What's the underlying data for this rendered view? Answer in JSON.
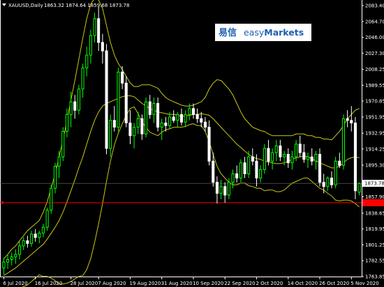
{
  "header": {
    "symbol_text": "XAUUSD,Daily",
    "ohlc_text": "1863.32 1874.64 1859.68 1873.78"
  },
  "logo": {
    "cn_text": "易信",
    "brand_prefix": "easy",
    "brand_suffix": "Markets"
  },
  "colors": {
    "background": "#000000",
    "candle_up": "#00ff00",
    "candle_down": "#ffffff",
    "bands": "#c8c814",
    "price_line": "#ff0000",
    "axis": "#ffffff",
    "logo_text": "#1d5fb0"
  },
  "chart_data": {
    "type": "candlestick",
    "symbol": "XAUUSD",
    "timeframe": "Daily",
    "ylim": [
      1763.85,
      2090
    ],
    "y_ticks": [
      {
        "value": 2083.4,
        "label": "2083.40"
      },
      {
        "value": 2064.7,
        "label": "2064.70"
      },
      {
        "value": 2046.0,
        "label": "2046.00"
      },
      {
        "value": 2027.3,
        "label": "2027.30"
      },
      {
        "value": 2008.25,
        "label": "2008.25"
      },
      {
        "value": 1989.55,
        "label": "1989.55"
      },
      {
        "value": 1970.85,
        "label": "1970.85"
      },
      {
        "value": 1951.95,
        "label": "1951.95"
      },
      {
        "value": 1932.95,
        "label": "1932.95"
      },
      {
        "value": 1914.25,
        "label": "1914.25"
      },
      {
        "value": 1895.3,
        "label": "1895.30"
      },
      {
        "value": 1857.9,
        "label": "1857.90"
      },
      {
        "value": 1838.65,
        "label": "1838.65"
      },
      {
        "value": 1819.95,
        "label": "1819.95"
      },
      {
        "value": 1801.25,
        "label": "1801.25"
      },
      {
        "value": 1782.55,
        "label": "1782.55"
      },
      {
        "value": 1763.85,
        "label": "1763.85"
      }
    ],
    "current_price_label": {
      "value": 1873.78,
      "label": "1873.78"
    },
    "horizontal_line": {
      "value": 1850.9,
      "label": ""
    },
    "x_ticks": [
      {
        "index": 0,
        "label": "6 Jul 2020"
      },
      {
        "index": 8,
        "label": "16 Jul 2020"
      },
      {
        "index": 17,
        "label": "28 Jul 2020"
      },
      {
        "index": 24,
        "label": "7 Aug 2020"
      },
      {
        "index": 32,
        "label": "19 Aug 2020"
      },
      {
        "index": 40,
        "label": "31 Aug 2020"
      },
      {
        "index": 48,
        "label": "10 Sep 2020"
      },
      {
        "index": 56,
        "label": "22 Sep 2020"
      },
      {
        "index": 64,
        "label": "2 Oct 2020"
      },
      {
        "index": 72,
        "label": "14 Oct 2020"
      },
      {
        "index": 80,
        "label": "26 Oct 2020"
      },
      {
        "index": 88,
        "label": "5 Nov 2020"
      }
    ],
    "candles": [
      {
        "o": 1774,
        "h": 1786,
        "l": 1766,
        "c": 1781
      },
      {
        "o": 1781,
        "h": 1790,
        "l": 1773,
        "c": 1784
      },
      {
        "o": 1784,
        "h": 1792,
        "l": 1777,
        "c": 1787
      },
      {
        "o": 1787,
        "h": 1796,
        "l": 1779,
        "c": 1790
      },
      {
        "o": 1790,
        "h": 1805,
        "l": 1784,
        "c": 1800
      },
      {
        "o": 1800,
        "h": 1810,
        "l": 1795,
        "c": 1806
      },
      {
        "o": 1806,
        "h": 1812,
        "l": 1798,
        "c": 1803
      },
      {
        "o": 1803,
        "h": 1818,
        "l": 1799,
        "c": 1814
      },
      {
        "o": 1814,
        "h": 1820,
        "l": 1805,
        "c": 1810
      },
      {
        "o": 1810,
        "h": 1818,
        "l": 1803,
        "c": 1815
      },
      {
        "o": 1815,
        "h": 1826,
        "l": 1810,
        "c": 1822
      },
      {
        "o": 1822,
        "h": 1845,
        "l": 1818,
        "c": 1842
      },
      {
        "o": 1842,
        "h": 1872,
        "l": 1838,
        "c": 1868
      },
      {
        "o": 1868,
        "h": 1898,
        "l": 1862,
        "c": 1894
      },
      {
        "o": 1894,
        "h": 1912,
        "l": 1880,
        "c": 1905
      },
      {
        "o": 1905,
        "h": 1940,
        "l": 1900,
        "c": 1935
      },
      {
        "o": 1935,
        "h": 1962,
        "l": 1928,
        "c": 1955
      },
      {
        "o": 1955,
        "h": 1982,
        "l": 1940,
        "c": 1970
      },
      {
        "o": 1970,
        "h": 1978,
        "l": 1950,
        "c": 1960
      },
      {
        "o": 1960,
        "h": 1990,
        "l": 1955,
        "c": 1985
      },
      {
        "o": 1985,
        "h": 2015,
        "l": 1975,
        "c": 2010
      },
      {
        "o": 2010,
        "h": 2035,
        "l": 2000,
        "c": 2025
      },
      {
        "o": 2025,
        "h": 2055,
        "l": 2015,
        "c": 2048
      },
      {
        "o": 2048,
        "h": 2075,
        "l": 2040,
        "c": 2068
      },
      {
        "o": 2068,
        "h": 2082,
        "l": 2030,
        "c": 2040
      },
      {
        "o": 2040,
        "h": 2050,
        "l": 2015,
        "c": 2030
      },
      {
        "o": 2030,
        "h": 2038,
        "l": 1908,
        "c": 1915
      },
      {
        "o": 1915,
        "h": 1955,
        "l": 1905,
        "c": 1948
      },
      {
        "o": 1948,
        "h": 1965,
        "l": 1935,
        "c": 1940
      },
      {
        "o": 1940,
        "h": 2010,
        "l": 1935,
        "c": 2005
      },
      {
        "o": 2005,
        "h": 2012,
        "l": 1985,
        "c": 1992
      },
      {
        "o": 1992,
        "h": 2000,
        "l": 1940,
        "c": 1945
      },
      {
        "o": 1945,
        "h": 1960,
        "l": 1920,
        "c": 1930
      },
      {
        "o": 1930,
        "h": 1945,
        "l": 1915,
        "c": 1940
      },
      {
        "o": 1940,
        "h": 1958,
        "l": 1932,
        "c": 1950
      },
      {
        "o": 1950,
        "h": 1955,
        "l": 1925,
        "c": 1932
      },
      {
        "o": 1932,
        "h": 1975,
        "l": 1928,
        "c": 1970
      },
      {
        "o": 1970,
        "h": 1978,
        "l": 1950,
        "c": 1955
      },
      {
        "o": 1955,
        "h": 1975,
        "l": 1945,
        "c": 1968
      },
      {
        "o": 1968,
        "h": 1975,
        "l": 1935,
        "c": 1940
      },
      {
        "o": 1940,
        "h": 1950,
        "l": 1925,
        "c": 1945
      },
      {
        "o": 1945,
        "h": 1952,
        "l": 1935,
        "c": 1942
      },
      {
        "o": 1942,
        "h": 1958,
        "l": 1938,
        "c": 1952
      },
      {
        "o": 1952,
        "h": 1960,
        "l": 1945,
        "c": 1948
      },
      {
        "o": 1948,
        "h": 1958,
        "l": 1940,
        "c": 1955
      },
      {
        "o": 1955,
        "h": 1962,
        "l": 1942,
        "c": 1946
      },
      {
        "o": 1946,
        "h": 1960,
        "l": 1940,
        "c": 1955
      },
      {
        "o": 1955,
        "h": 1968,
        "l": 1948,
        "c": 1962
      },
      {
        "o": 1962,
        "h": 1968,
        "l": 1950,
        "c": 1955
      },
      {
        "o": 1955,
        "h": 1962,
        "l": 1945,
        "c": 1950
      },
      {
        "o": 1950,
        "h": 1958,
        "l": 1940,
        "c": 1946
      },
      {
        "o": 1946,
        "h": 1952,
        "l": 1935,
        "c": 1940
      },
      {
        "o": 1940,
        "h": 1948,
        "l": 1895,
        "c": 1900
      },
      {
        "o": 1900,
        "h": 1910,
        "l": 1870,
        "c": 1875
      },
      {
        "o": 1875,
        "h": 1882,
        "l": 1850,
        "c": 1862
      },
      {
        "o": 1862,
        "h": 1878,
        "l": 1855,
        "c": 1870
      },
      {
        "o": 1870,
        "h": 1875,
        "l": 1851,
        "c": 1860
      },
      {
        "o": 1860,
        "h": 1880,
        "l": 1855,
        "c": 1875
      },
      {
        "o": 1875,
        "h": 1890,
        "l": 1868,
        "c": 1885
      },
      {
        "o": 1885,
        "h": 1895,
        "l": 1875,
        "c": 1880
      },
      {
        "o": 1880,
        "h": 1902,
        "l": 1875,
        "c": 1898
      },
      {
        "o": 1898,
        "h": 1905,
        "l": 1880,
        "c": 1885
      },
      {
        "o": 1885,
        "h": 1912,
        "l": 1880,
        "c": 1905
      },
      {
        "o": 1905,
        "h": 1915,
        "l": 1895,
        "c": 1900
      },
      {
        "o": 1900,
        "h": 1908,
        "l": 1870,
        "c": 1880
      },
      {
        "o": 1880,
        "h": 1895,
        "l": 1875,
        "c": 1890
      },
      {
        "o": 1890,
        "h": 1920,
        "l": 1885,
        "c": 1915
      },
      {
        "o": 1915,
        "h": 1925,
        "l": 1895,
        "c": 1900
      },
      {
        "o": 1900,
        "h": 1915,
        "l": 1890,
        "c": 1910
      },
      {
        "o": 1910,
        "h": 1925,
        "l": 1900,
        "c": 1918
      },
      {
        "o": 1918,
        "h": 1925,
        "l": 1900,
        "c": 1905
      },
      {
        "o": 1905,
        "h": 1912,
        "l": 1895,
        "c": 1908
      },
      {
        "o": 1908,
        "h": 1915,
        "l": 1892,
        "c": 1898
      },
      {
        "o": 1898,
        "h": 1912,
        "l": 1890,
        "c": 1905
      },
      {
        "o": 1905,
        "h": 1925,
        "l": 1900,
        "c": 1920
      },
      {
        "o": 1920,
        "h": 1930,
        "l": 1905,
        "c": 1910
      },
      {
        "o": 1910,
        "h": 1920,
        "l": 1898,
        "c": 1902
      },
      {
        "o": 1902,
        "h": 1910,
        "l": 1892,
        "c": 1905
      },
      {
        "o": 1905,
        "h": 1915,
        "l": 1895,
        "c": 1900
      },
      {
        "o": 1900,
        "h": 1912,
        "l": 1890,
        "c": 1908
      },
      {
        "o": 1908,
        "h": 1915,
        "l": 1870,
        "c": 1875
      },
      {
        "o": 1875,
        "h": 1885,
        "l": 1862,
        "c": 1870
      },
      {
        "o": 1870,
        "h": 1882,
        "l": 1865,
        "c": 1880
      },
      {
        "o": 1880,
        "h": 1888,
        "l": 1868,
        "c": 1872
      },
      {
        "o": 1872,
        "h": 1905,
        "l": 1868,
        "c": 1900
      },
      {
        "o": 1900,
        "h": 1910,
        "l": 1892,
        "c": 1895
      },
      {
        "o": 1895,
        "h": 1955,
        "l": 1890,
        "c": 1950
      },
      {
        "o": 1950,
        "h": 1960,
        "l": 1940,
        "c": 1948
      },
      {
        "o": 1948,
        "h": 1965,
        "l": 1935,
        "c": 1945
      },
      {
        "o": 1945,
        "h": 1952,
        "l": 1855,
        "c": 1865
      },
      {
        "o": 1863.32,
        "h": 1874.64,
        "l": 1859.68,
        "c": 1873.78
      }
    ],
    "bollinger": {
      "upper": [
        1785,
        1790,
        1796,
        1800,
        1806,
        1812,
        1818,
        1822,
        1826,
        1830,
        1840,
        1852,
        1868,
        1885,
        1905,
        1925,
        1948,
        1972,
        1995,
        2020,
        2045,
        2068,
        2085,
        2092,
        2090,
        2080,
        2060,
        2040,
        2025,
        2015,
        2008,
        2000,
        1992,
        1988,
        1988,
        1990,
        1990,
        1990,
        1988,
        1986,
        1980,
        1975,
        1972,
        1970,
        1968,
        1966,
        1965,
        1965,
        1966,
        1968,
        1970,
        1975,
        1985,
        1992,
        1996,
        1995,
        1990,
        1985,
        1978,
        1968,
        1958,
        1950,
        1945,
        1940,
        1938,
        1936,
        1935,
        1932,
        1930,
        1930,
        1930,
        1930,
        1930,
        1930,
        1932,
        1932,
        1932,
        1930,
        1930,
        1928,
        1928,
        1926,
        1926,
        1925,
        1930,
        1935,
        1942,
        1950,
        1955,
        1960,
        1962
      ],
      "middle": [
        1765,
        1768,
        1771,
        1774,
        1778,
        1782,
        1786,
        1790,
        1794,
        1798,
        1802,
        1808,
        1815,
        1822,
        1830,
        1840,
        1852,
        1865,
        1878,
        1892,
        1905,
        1920,
        1935,
        1948,
        1958,
        1965,
        1968,
        1970,
        1972,
        1974,
        1976,
        1977,
        1977,
        1976,
        1972,
        1968,
        1965,
        1962,
        1960,
        1958,
        1957,
        1956,
        1955,
        1955,
        1954,
        1953,
        1953,
        1954,
        1955,
        1955,
        1956,
        1955,
        1954,
        1950,
        1945,
        1940,
        1935,
        1930,
        1925,
        1920,
        1916,
        1912,
        1908,
        1905,
        1903,
        1902,
        1900,
        1899,
        1898,
        1897,
        1897,
        1898,
        1900,
        1902,
        1904,
        1905,
        1906,
        1905,
        1903,
        1900,
        1898,
        1896,
        1894,
        1892,
        1892,
        1894,
        1898,
        1902,
        1904,
        1905,
        1904
      ],
      "lower": [
        1745,
        1746,
        1746,
        1748,
        1750,
        1752,
        1754,
        1758,
        1762,
        1766,
        1764,
        1764,
        1762,
        1759,
        1755,
        1755,
        1756,
        1758,
        1761,
        1764,
        1765,
        1772,
        1785,
        1804,
        1826,
        1850,
        1876,
        1900,
        1919,
        1933,
        1944,
        1954,
        1962,
        1964,
        1956,
        1946,
        1940,
        1934,
        1932,
        1930,
        1934,
        1937,
        1938,
        1940,
        1940,
        1940,
        1941,
        1943,
        1944,
        1942,
        1942,
        1935,
        1923,
        1908,
        1894,
        1885,
        1880,
        1875,
        1872,
        1872,
        1874,
        1874,
        1871,
        1870,
        1868,
        1868,
        1865,
        1866,
        1866,
        1864,
        1864,
        1866,
        1870,
        1874,
        1876,
        1878,
        1880,
        1880,
        1876,
        1872,
        1868,
        1866,
        1862,
        1859,
        1854,
        1853,
        1854,
        1854,
        1853,
        1850,
        1846
      ]
    }
  }
}
